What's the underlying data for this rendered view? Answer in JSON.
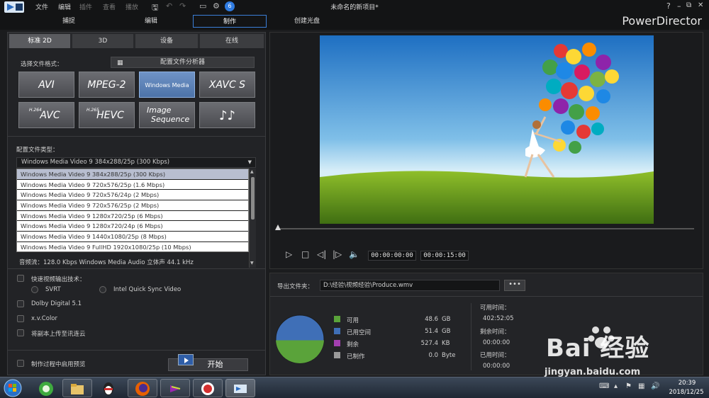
{
  "app": {
    "brand": "PowerDirector",
    "window_title": "未命名的新项目*"
  },
  "menu": {
    "items": [
      {
        "label": "文件",
        "enabled": true
      },
      {
        "label": "编辑",
        "enabled": true
      },
      {
        "label": "插件",
        "enabled": false
      },
      {
        "label": "查看",
        "enabled": false
      },
      {
        "label": "播放",
        "enabled": false
      }
    ],
    "notification_badge": "6"
  },
  "window_controls": {
    "help": "?",
    "minimize": "–",
    "restore": "⧉",
    "close": "✕"
  },
  "mode_tabs": [
    {
      "label": "捕捉",
      "active": false
    },
    {
      "label": "编辑",
      "active": false
    },
    {
      "label": "制作",
      "active": true
    },
    {
      "label": "创建光盘",
      "active": false
    }
  ],
  "sub_tabs": [
    {
      "label": "标准 2D",
      "active": true
    },
    {
      "label": "3D",
      "active": false
    },
    {
      "label": "设备",
      "active": false
    },
    {
      "label": "在线",
      "active": false
    }
  ],
  "format_section": {
    "label": "选择文件格式：",
    "analyzer_button": "配置文件分析器",
    "formats": [
      {
        "label": "AVI",
        "active": false
      },
      {
        "label": "MPEG-2",
        "active": false
      },
      {
        "label": "Windows Media",
        "active": true
      },
      {
        "label": "XAVC S",
        "active": false
      },
      {
        "label": "AVC",
        "prefix": "H.264",
        "active": false
      },
      {
        "label": "HEVC",
        "prefix": "H.265",
        "active": false
      },
      {
        "label_line1": "Image",
        "label_line2": "Sequence",
        "active": false
      },
      {
        "label": "♪♪",
        "active": false
      }
    ]
  },
  "profile": {
    "label": "配置文件类型：",
    "selected": "Windows Media Video 9 384x288/25p (300 Kbps)",
    "options": [
      "Windows Media Video 9 384x288/25p (300 Kbps)",
      "Windows Media Video 9 720x576/25p (1.6 Mbps)",
      "Windows Media Video 9 720x576/24p (2 Mbps)",
      "Windows Media Video 9 720x576/25p (2 Mbps)",
      "Windows Media Video 9 1280x720/25p (6 Mbps)",
      "Windows Media Video 9 1280x720/24p (6 Mbps)",
      "Windows Media Video 9 1440x1080/25p (8 Mbps)",
      "Windows Media Video 9 FullHD 1920x1080/25p (10 Mbps)"
    ],
    "audio_info": "音频流：128.0 Kbps  Windows Media Audio  立体声  44.1 kHz"
  },
  "options": {
    "fast_render_label": "快速视频输出技术：",
    "svrt_label": "SVRT",
    "quicksync_label": "Intel Quick Sync Video",
    "dolby_label": "Dolby Digital 5.1",
    "xvcolor_label": "x.v.Color",
    "upload_label": "将副本上传至讯连云",
    "preview_label": "制作过程中启用预览"
  },
  "start_button": "开始",
  "player": {
    "current_time": "00:00:00:00",
    "duration": "00:00:15:00",
    "progress": 0
  },
  "output": {
    "folder_label": "导出文件夹：",
    "folder_path": "D:\\经验\\视频经验\\Produce.wmv",
    "browse_label": "•••",
    "legend": [
      {
        "name": "可用",
        "value": "48.6",
        "unit": "GB",
        "color": "#5aa33a"
      },
      {
        "name": "已用空间",
        "value": "51.4",
        "unit": "GB",
        "color": "#3f6fb7"
      },
      {
        "name": "剩余",
        "value": "527.4",
        "unit": "KB",
        "color": "#a23fb0"
      },
      {
        "name": "已制作",
        "value": "0.0",
        "unit": "Byte",
        "color": "#9a9a9a"
      }
    ],
    "disk_available_fraction": 0.486,
    "times": [
      {
        "label": "可用时间：",
        "value": "402:52:05"
      },
      {
        "label": "剩余时间：",
        "value": "00:00:00"
      },
      {
        "label": "已用时间：",
        "value": "00:00:00"
      }
    ]
  },
  "watermark": {
    "text": "Bai 经验",
    "url": "jingyan.baidu.com"
  },
  "taskbar": {
    "time": "20:39",
    "date": "2018/12/25"
  }
}
